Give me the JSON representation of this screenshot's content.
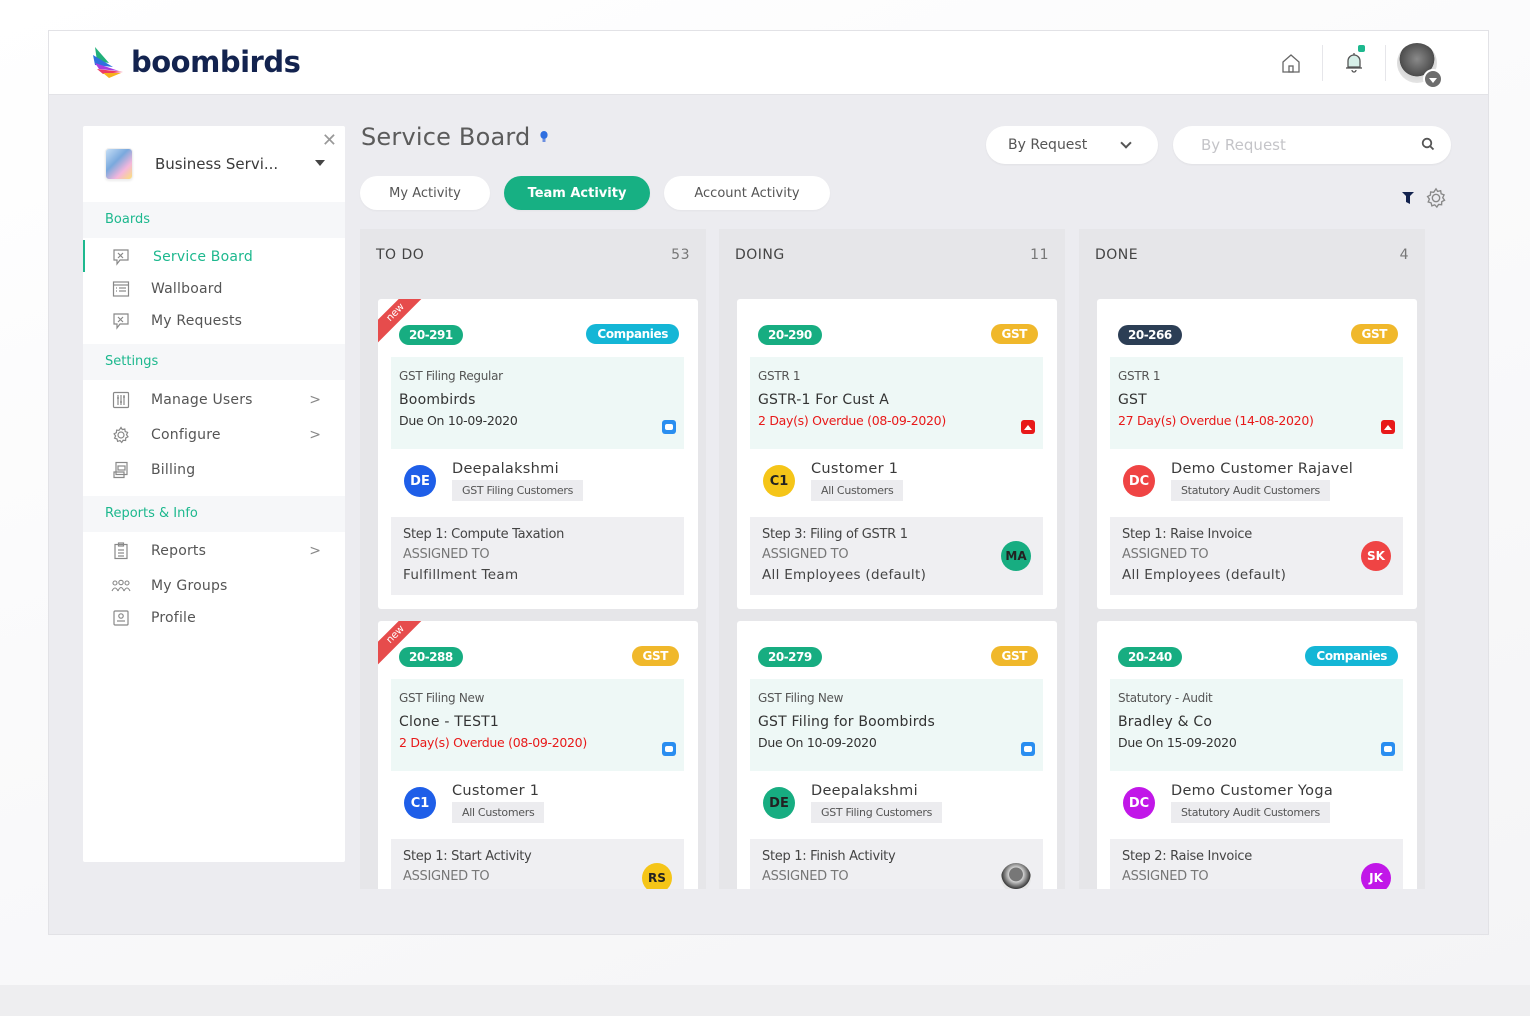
{
  "app": {
    "brand": "boombirds",
    "brand_color": "#13234f",
    "accent_color": "#1db88e"
  },
  "topbar": {
    "icons": [
      "home-icon",
      "bell-icon",
      "user-avatar"
    ],
    "notification_dot": true
  },
  "sidebar": {
    "org_name": "Business Servi...",
    "sections": [
      {
        "label": "Boards",
        "items": [
          {
            "label": "Service Board",
            "icon": "service-icon",
            "active": true
          },
          {
            "label": "Wallboard",
            "icon": "wallboard-icon"
          },
          {
            "label": "My Requests",
            "icon": "requests-icon"
          }
        ]
      },
      {
        "label": "Settings",
        "items": [
          {
            "label": "Manage Users",
            "icon": "sliders-icon",
            "chevron": true
          },
          {
            "label": "Configure",
            "icon": "gear-icon",
            "chevron": true
          },
          {
            "label": "Billing",
            "icon": "billing-icon"
          }
        ]
      },
      {
        "label": "Reports & Info",
        "items": [
          {
            "label": "Reports",
            "icon": "clipboard-icon",
            "chevron": true
          },
          {
            "label": "My Groups",
            "icon": "groups-icon"
          },
          {
            "label": "Profile",
            "icon": "profile-icon"
          }
        ]
      }
    ]
  },
  "main": {
    "title": "Service Board",
    "tabs": [
      {
        "label": "My Activity",
        "active": false
      },
      {
        "label": "Team Activity",
        "active": true
      },
      {
        "label": "Account Activity",
        "active": false
      }
    ],
    "filter_select": {
      "value": "By Request"
    },
    "search": {
      "placeholder": "By Request",
      "value": ""
    }
  },
  "columns": [
    {
      "name": "TO DO",
      "count": "53",
      "cards": [
        {
          "new": true,
          "new_label": "new",
          "id": "20-291",
          "id_style": "green",
          "tag": "Companies",
          "tag_style": "companies",
          "type": "GST Filing Regular",
          "title": "Boombirds",
          "due": "Due On 10-09-2020",
          "overdue": false,
          "customer": {
            "initials": "DE",
            "name": "Deepalakshmi",
            "group": "GST Filing Customers",
            "color": "#1e5ee8"
          },
          "step": "Step 1: Compute Taxation",
          "assigned_label": "ASSIGNED TO",
          "assigned_to": "Fulfillment Team",
          "assignee": null
        },
        {
          "new": true,
          "new_label": "new",
          "id": "20-288",
          "id_style": "green",
          "tag": "GST",
          "tag_style": "gst",
          "type": "GST Filing New",
          "title": "Clone - TEST1",
          "due": "2 Day(s) Overdue (08-09-2020)",
          "overdue": true,
          "flag": "blue",
          "customer": {
            "initials": "C1",
            "name": "Customer 1",
            "group": "All Customers",
            "color": "#1e5ee8"
          },
          "step": "Step 1: Start Activity",
          "assigned_label": "ASSIGNED TO",
          "assigned_to": "",
          "assignee": {
            "initials": "RS",
            "color": "#f5c518",
            "text_color": "#222"
          }
        }
      ]
    },
    {
      "name": "DOING",
      "count": "11",
      "cards": [
        {
          "new": false,
          "id": "20-290",
          "id_style": "green",
          "tag": "GST",
          "tag_style": "gst",
          "type": "GSTR 1",
          "title": "GSTR-1 For Cust A",
          "due": "2 Day(s) Overdue (08-09-2020)",
          "overdue": true,
          "customer": {
            "initials": "C1",
            "name": "Customer 1",
            "group": "All Customers",
            "color": "#f5c518",
            "text_color": "#222"
          },
          "step": "Step 3: Filing of GSTR 1",
          "assigned_label": "ASSIGNED TO",
          "assigned_to": "All Employees (default)",
          "assignee": {
            "initials": "MA",
            "color": "#17ad81",
            "text_color": "#222"
          }
        },
        {
          "new": false,
          "id": "20-279",
          "id_style": "green",
          "tag": "GST",
          "tag_style": "gst",
          "type": "GST Filing New",
          "title": "GST Filing for Boombirds",
          "due": "Due On 10-09-2020",
          "overdue": false,
          "customer": {
            "initials": "DE",
            "name": "Deepalakshmi",
            "group": "GST Filing Customers",
            "color": "#17ad81",
            "text_color": "#222"
          },
          "step": "Step 1: Finish Activity",
          "assigned_label": "ASSIGNED TO",
          "assigned_to": "",
          "assignee": {
            "photo": true
          }
        }
      ]
    },
    {
      "name": "DONE",
      "count": "4",
      "cards": [
        {
          "new": false,
          "id": "20-266",
          "id_style": "dark",
          "tag": "GST",
          "tag_style": "gst",
          "type": "GSTR 1",
          "title": "GST",
          "due": "27 Day(s) Overdue (14-08-2020)",
          "overdue": true,
          "customer": {
            "initials": "DC",
            "name": "Demo Customer Rajavel",
            "group": "Statutory Audit Customers",
            "color": "#ef4444"
          },
          "step": "Step 1: Raise Invoice",
          "assigned_label": "ASSIGNED TO",
          "assigned_to": "All Employees (default)",
          "assignee": {
            "initials": "SK",
            "color": "#ef4444",
            "text_color": "#fff"
          }
        },
        {
          "new": false,
          "id": "20-240",
          "id_style": "green",
          "tag": "Companies",
          "tag_style": "companies",
          "type": "Statutory - Audit",
          "title": "Bradley & Co",
          "due": "Due On 15-09-2020",
          "overdue": false,
          "customer": {
            "initials": "DC",
            "name": "Demo Customer Yoga",
            "group": "Statutory Audit Customers",
            "color": "#c117e8"
          },
          "step": "Step 2: Raise Invoice",
          "assigned_label": "ASSIGNED TO",
          "assigned_to": "",
          "assignee": {
            "initials": "JK",
            "color": "#c117e8",
            "text_color": "#fff"
          }
        }
      ]
    }
  ]
}
